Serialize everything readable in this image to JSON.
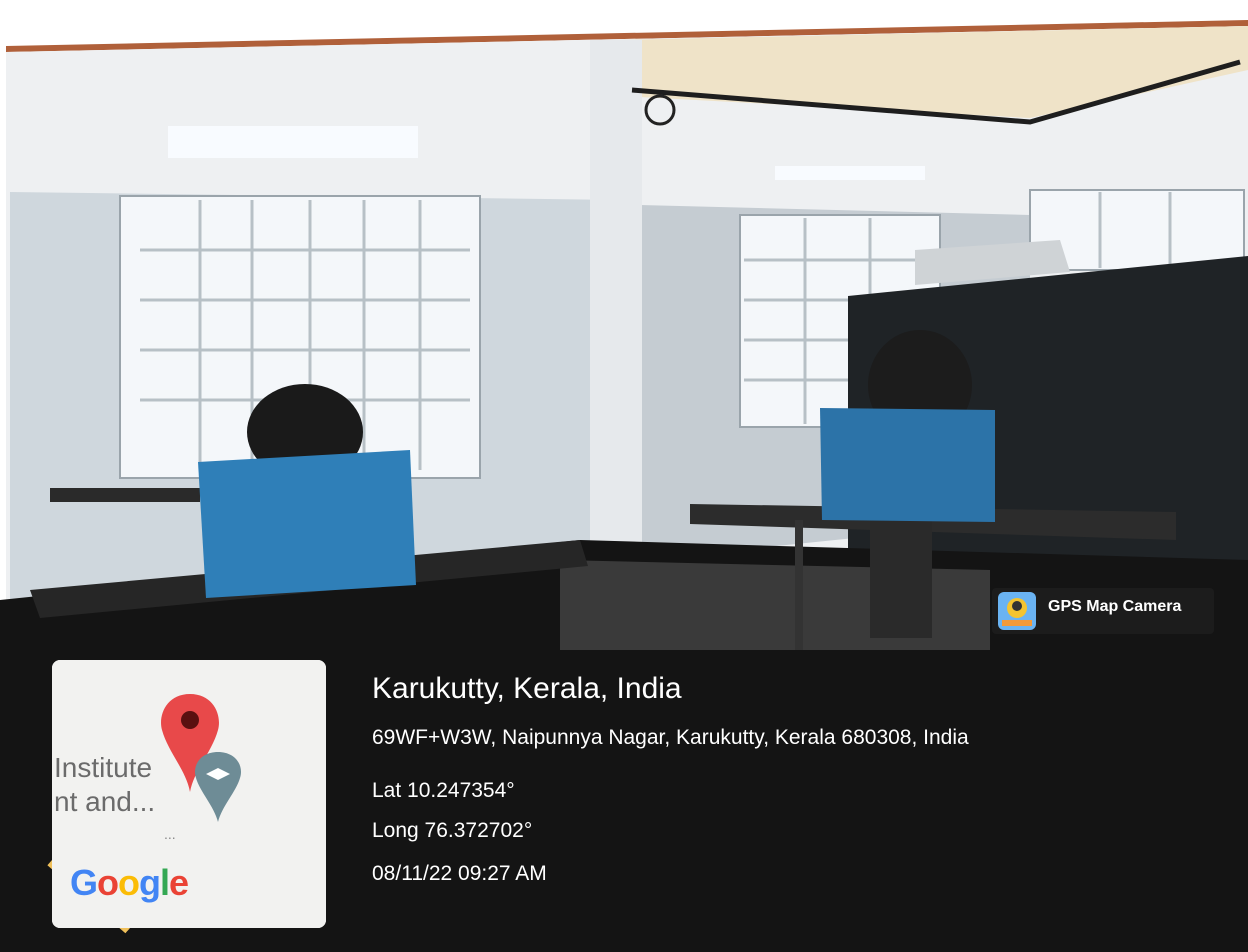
{
  "location": {
    "title": "Karukutty, Kerala, India",
    "address": "69WF+W3W, Naipunnya Nagar, Karukutty, Kerala 680308, India",
    "latitude": "Lat 10.247354°",
    "longitude": "Long 76.372702°",
    "timestamp": "08/11/22 09:27 AM"
  },
  "badge": {
    "label": "GPS Map Camera",
    "icon": "gps-camera-icon"
  },
  "map_card": {
    "line1": "Institute",
    "line2": "nt and...",
    "ellipsis": "...",
    "brand": "Google",
    "brand_letters": [
      "G",
      "o",
      "o",
      "g",
      "l",
      "e"
    ],
    "brand_colors": [
      "#4285F4",
      "#EA4335",
      "#FBBC05",
      "#4285F4",
      "#34A853",
      "#EA4335"
    ],
    "pin_icon": "map-pin-icon",
    "education_icon": "graduation-cap-icon"
  },
  "colors": {
    "overlay_bg": "#141414",
    "pin_red": "#e8494a",
    "booth_blue": "#2f7fb8"
  }
}
